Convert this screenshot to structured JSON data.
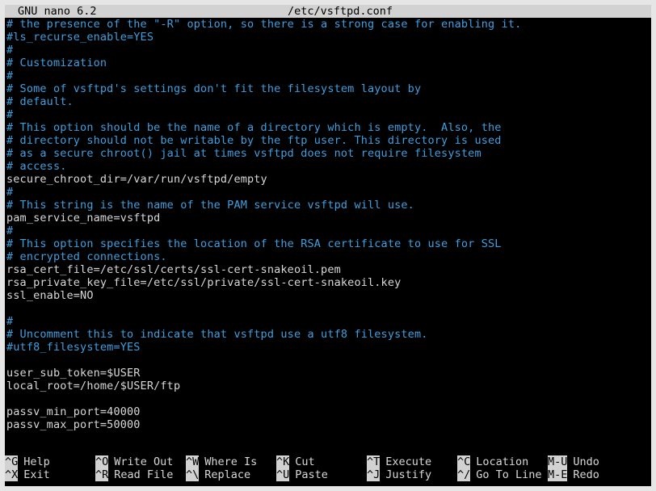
{
  "titlebar": {
    "app": "GNU nano 6.2",
    "file": "/etc/vsftpd.conf"
  },
  "editor": {
    "lines": [
      {
        "text": "# the presence of the \"-R\" option, so there is a strong case for enabling it.",
        "kind": "comment"
      },
      {
        "text": "#ls_recurse_enable=YES",
        "kind": "comment"
      },
      {
        "text": "#",
        "kind": "comment"
      },
      {
        "text": "# Customization",
        "kind": "comment"
      },
      {
        "text": "#",
        "kind": "comment"
      },
      {
        "text": "# Some of vsftpd's settings don't fit the filesystem layout by",
        "kind": "comment"
      },
      {
        "text": "# default.",
        "kind": "comment"
      },
      {
        "text": "#",
        "kind": "comment"
      },
      {
        "text": "# This option should be the name of a directory which is empty.  Also, the",
        "kind": "comment"
      },
      {
        "text": "# directory should not be writable by the ftp user. This directory is used",
        "kind": "comment"
      },
      {
        "text": "# as a secure chroot() jail at times vsftpd does not require filesystem",
        "kind": "comment"
      },
      {
        "text": "# access.",
        "kind": "comment"
      },
      {
        "text": "secure_chroot_dir=/var/run/vsftpd/empty",
        "kind": "code"
      },
      {
        "text": "#",
        "kind": "comment"
      },
      {
        "text": "# This string is the name of the PAM service vsftpd will use.",
        "kind": "comment"
      },
      {
        "text": "pam_service_name=vsftpd",
        "kind": "code"
      },
      {
        "text": "#",
        "kind": "comment"
      },
      {
        "text": "# This option specifies the location of the RSA certificate to use for SSL",
        "kind": "comment"
      },
      {
        "text": "# encrypted connections.",
        "kind": "comment"
      },
      {
        "text": "rsa_cert_file=/etc/ssl/certs/ssl-cert-snakeoil.pem",
        "kind": "code"
      },
      {
        "text": "rsa_private_key_file=/etc/ssl/private/ssl-cert-snakeoil.key",
        "kind": "code"
      },
      {
        "text": "ssl_enable=NO",
        "kind": "code"
      },
      {
        "text": "",
        "kind": "code"
      },
      {
        "text": "#",
        "kind": "comment"
      },
      {
        "text": "# Uncomment this to indicate that vsftpd use a utf8 filesystem.",
        "kind": "comment"
      },
      {
        "text": "#utf8_filesystem=YES",
        "kind": "comment"
      },
      {
        "text": "",
        "kind": "code"
      },
      {
        "text": "user_sub_token=$USER",
        "kind": "code"
      },
      {
        "text": "local_root=/home/$USER/ftp",
        "kind": "code"
      },
      {
        "text": "",
        "kind": "code"
      },
      {
        "text": "passv_min_port=40000",
        "kind": "code"
      },
      {
        "text": "passv_max_port=50000",
        "kind": "code"
      }
    ]
  },
  "shortcuts": {
    "row1": [
      {
        "key": "^G",
        "label": "Help"
      },
      {
        "key": "^O",
        "label": "Write Out"
      },
      {
        "key": "^W",
        "label": "Where Is"
      },
      {
        "key": "^K",
        "label": "Cut"
      },
      {
        "key": "^T",
        "label": "Execute"
      },
      {
        "key": "^C",
        "label": "Location"
      },
      {
        "key": "M-U",
        "label": "Undo"
      }
    ],
    "row2": [
      {
        "key": "^X",
        "label": "Exit"
      },
      {
        "key": "^R",
        "label": "Read File"
      },
      {
        "key": "^\\",
        "label": "Replace"
      },
      {
        "key": "^U",
        "label": "Paste"
      },
      {
        "key": "^J",
        "label": "Justify"
      },
      {
        "key": "^/",
        "label": "Go To Line"
      },
      {
        "key": "M-E",
        "label": "Redo"
      }
    ]
  },
  "colors": {
    "background": "#000000",
    "comment": "#3f9fe0",
    "text": "#d8d8d8",
    "titlebar": "#d2d2d2"
  }
}
